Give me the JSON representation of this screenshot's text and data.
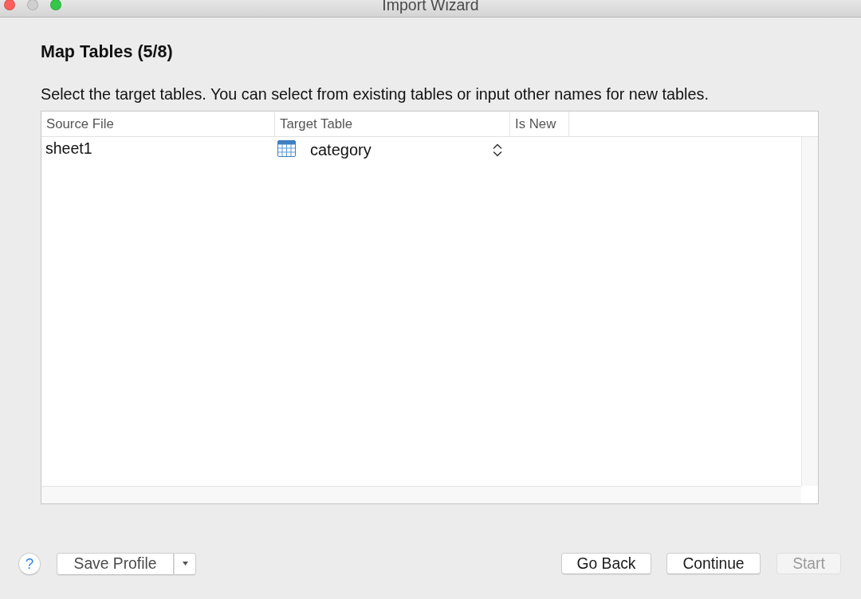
{
  "window": {
    "title": "Import Wizard",
    "controls": [
      {
        "kind": "close",
        "disabled": false
      },
      {
        "kind": "minimize",
        "disabled": true
      },
      {
        "kind": "zoom",
        "disabled": false
      }
    ]
  },
  "step": {
    "title": "Map Tables (5/8)",
    "instruction": "Select the target tables. You can select from existing tables or input other names for new tables."
  },
  "table": {
    "columns": [
      "Source File",
      "Target Table",
      "Is New"
    ],
    "rows": [
      {
        "source_file": "sheet1",
        "target_table": "category"
      }
    ]
  },
  "footer": {
    "help": "?",
    "save_profile": "Save Profile",
    "buttons": [
      {
        "label": "Go Back",
        "disabled": false
      },
      {
        "label": "Continue",
        "disabled": false
      },
      {
        "label": "Start",
        "disabled": true
      }
    ]
  }
}
